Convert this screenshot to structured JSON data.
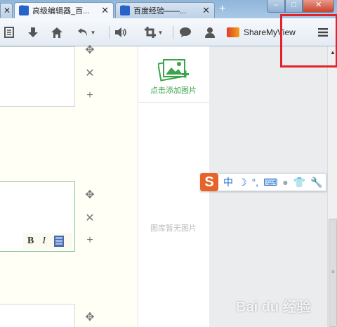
{
  "browser": {
    "tabs": [
      {
        "title": "高级编辑器_百...",
        "active": true
      },
      {
        "title": "百度经验——...",
        "active": false
      }
    ],
    "new_tab_label": "+",
    "close_glyph": "✕",
    "window_controls": {
      "minimize": "–",
      "maximize": "□",
      "close": "✕"
    }
  },
  "toolbar": {
    "icons": [
      "reader-icon",
      "download-icon",
      "home-icon",
      "undo-icon",
      "speaker-icon",
      "crop-icon",
      "chat-icon",
      "user-icon",
      "sharemyview-icon",
      "menu-icon"
    ],
    "sharemyview_label": "ShareMyView"
  },
  "editor": {
    "format_bold": "B",
    "format_italic": "I",
    "controls": {
      "move": "✥",
      "remove": "✕",
      "add": "+"
    }
  },
  "gallery": {
    "add_image_label": "点击添加图片",
    "empty_label": "图库暂无图片"
  },
  "ime_bar": {
    "logo": "S",
    "mode": "中",
    "icons": [
      "moon-icon",
      "punctuation-icon",
      "keyboard-icon",
      "user-icon",
      "shirt-icon",
      "wrench-icon"
    ]
  },
  "watermark": "Bai du 经验",
  "colors": {
    "highlight": "#e2232a",
    "accent_green": "#3aa44a"
  }
}
